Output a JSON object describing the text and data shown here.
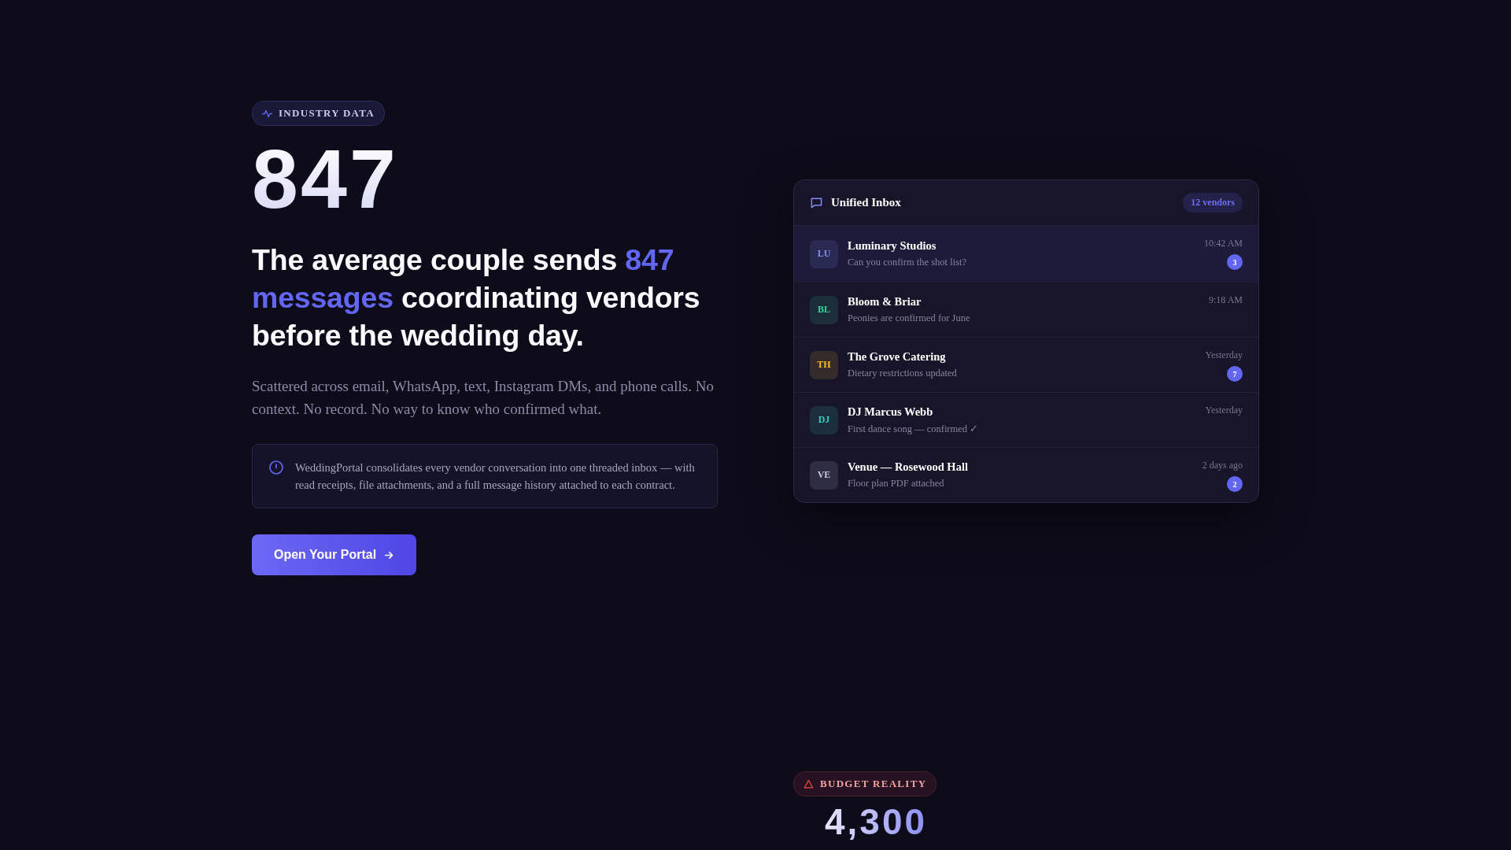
{
  "hero": {
    "badge": "INDUSTRY DATA",
    "stat": "847",
    "headline": "The average couple sends **847 messages** coordinating vendors before the wedding day.",
    "body": "Scattered across email, WhatsApp, text, Instagram DMs, and phone calls. No context. No record. No way to know who confirmed what.",
    "note": "WeddingPortal consolidates every vendor conversation into one threaded inbox — with read receipts, file attachments, and a full message history attached to each contract.",
    "button": "Open Your Portal"
  },
  "inbox": {
    "title": "Unified Inbox",
    "count": "12 vendors",
    "threads": [
      {
        "initials": "LU",
        "color": "#818cf8",
        "name": "Luminary Studios",
        "preview": "Can you confirm the shot list?",
        "time": "10:42 AM",
        "unread": "3",
        "selected": true
      },
      {
        "initials": "BL",
        "color": "#34d399",
        "name": "Bloom & Briar",
        "preview": "Peonies are confirmed for June",
        "time": "9:18 AM",
        "selected": false
      },
      {
        "initials": "TH",
        "color": "#fbbf24",
        "name": "The Grove Catering",
        "preview": "Dietary restrictions updated",
        "time": "Yesterday",
        "unread": "7",
        "selected": false
      },
      {
        "initials": "DJ",
        "color": "#2dd4bf",
        "name": "DJ Marcus Webb",
        "preview": "First dance song — confirmed ✓",
        "time": "Yesterday",
        "selected": false
      },
      {
        "initials": "VE",
        "color": "#c7c9e0",
        "name": "Venue — Rosewood Hall",
        "preview": "Floor plan PDF attached",
        "time": "2 days ago",
        "unread": "2",
        "selected": false
      }
    ]
  },
  "budget": {
    "badge": "BUDGET REALITY",
    "stat": "4,300"
  }
}
